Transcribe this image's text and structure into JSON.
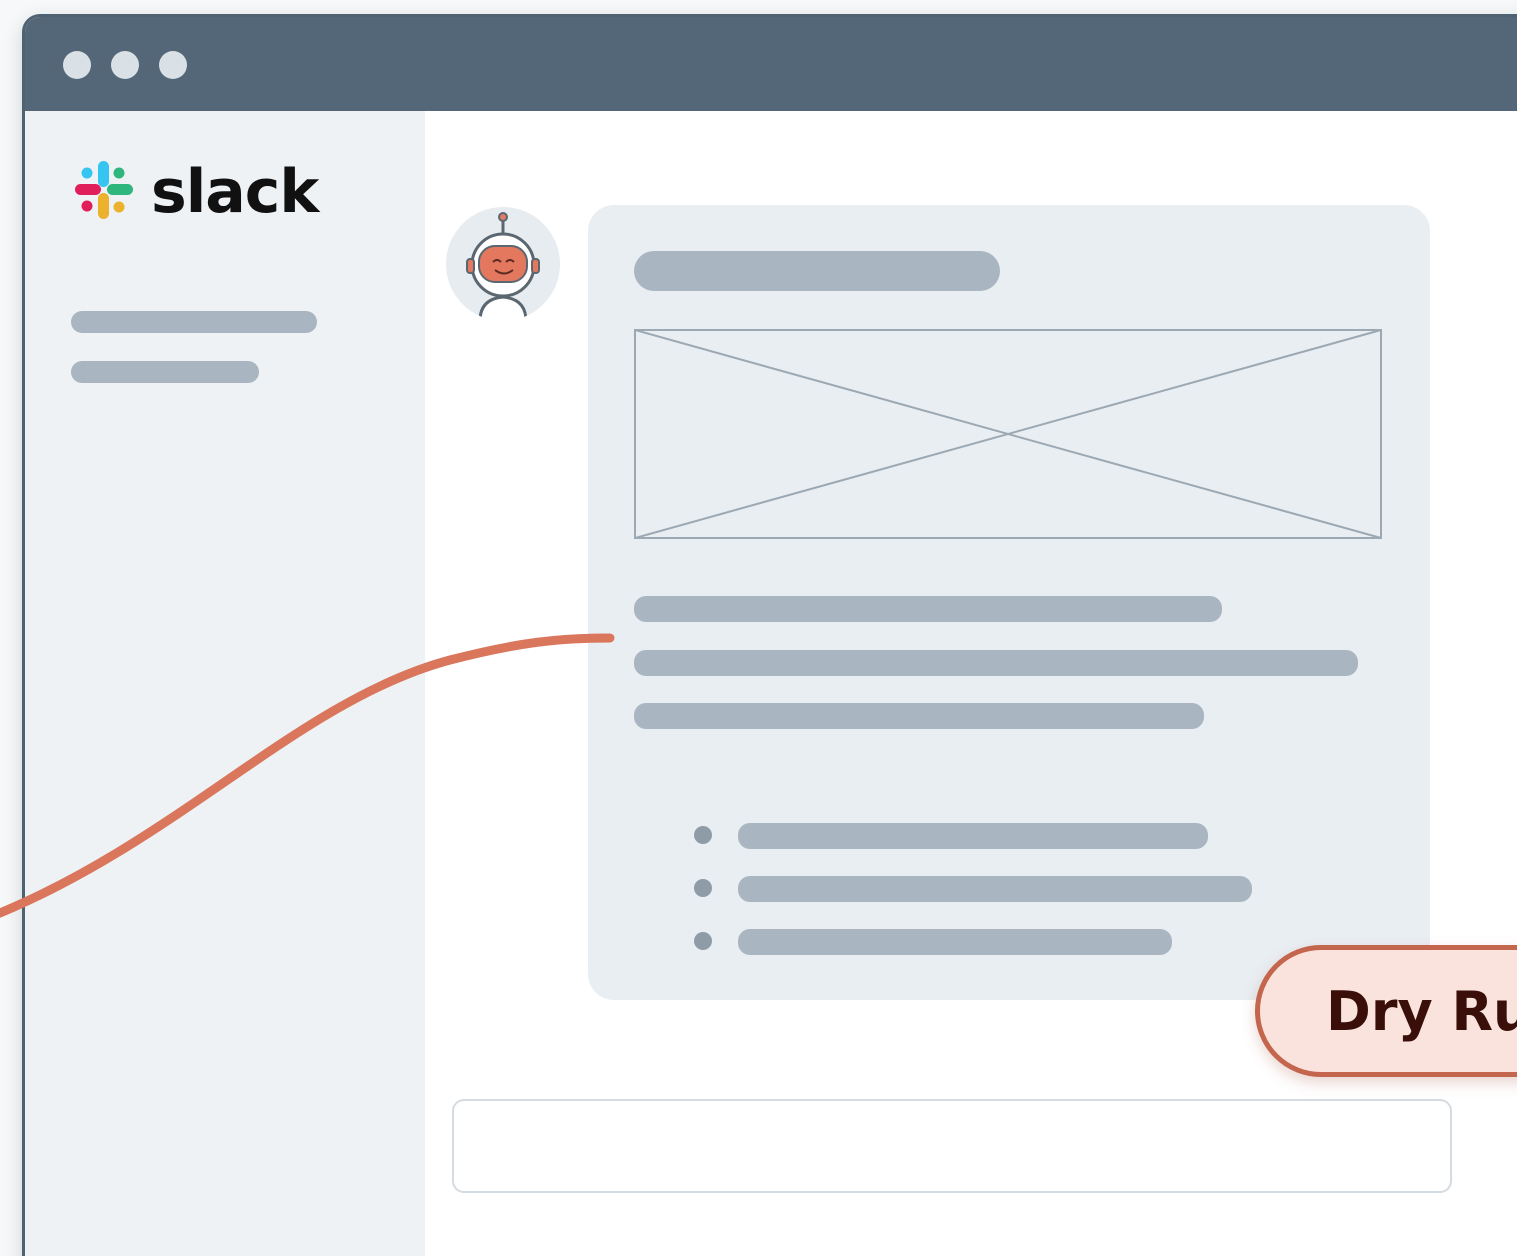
{
  "app": {
    "brand": {
      "name": "slack",
      "logo_icon": "slack-logo-icon",
      "logo_colors": [
        "#36c5f0",
        "#2eb67d",
        "#ecb22e",
        "#e01e5a"
      ]
    }
  },
  "window": {
    "titlebar_color": "#546779",
    "controls": [
      "close-dot",
      "minimize-dot",
      "maximize-dot"
    ]
  },
  "message": {
    "avatar_icon": "robot-avatar-icon",
    "attachment_icon": "image-placeholder-icon",
    "bullet_count": 3
  },
  "action": {
    "dry_run_label": "Dry Ru",
    "accent_color": "#d9765c"
  }
}
